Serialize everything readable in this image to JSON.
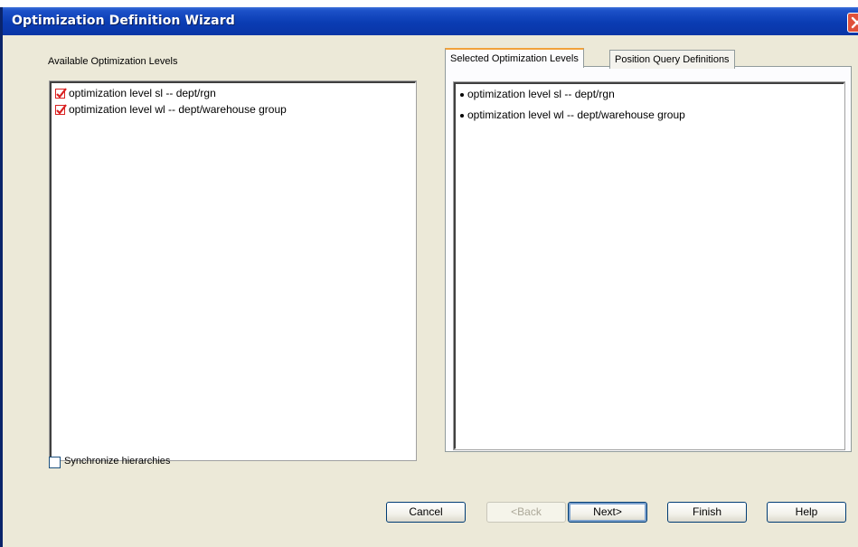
{
  "window": {
    "title": "Optimization Definition Wizard"
  },
  "available": {
    "label": "Available Optimization Levels",
    "items": [
      "optimization level sl -- dept/rgn",
      "optimization level wl -- dept/warehouse group"
    ]
  },
  "tabs": [
    {
      "label": "Selected Optimization Levels",
      "selected": true
    },
    {
      "label": "Position Query Definitions",
      "selected": false
    }
  ],
  "selected": {
    "items": [
      "optimization level sl -- dept/rgn",
      "optimization level wl -- dept/warehouse group"
    ]
  },
  "sync": {
    "label": "Synchronize hierarchies",
    "checked": false
  },
  "buttons": {
    "cancel": "Cancel",
    "back": "<Back",
    "next": "Next>",
    "finish": "Finish",
    "help": "Help"
  },
  "colors": {
    "titlebar": "#0a3cb3",
    "dialog": "#ece9d8",
    "check": "#d92020",
    "tab_accent": "#f1a13b"
  },
  "icons": {
    "close": "close-icon",
    "check": "checkmark-icon",
    "bullet": "bullet-icon"
  }
}
